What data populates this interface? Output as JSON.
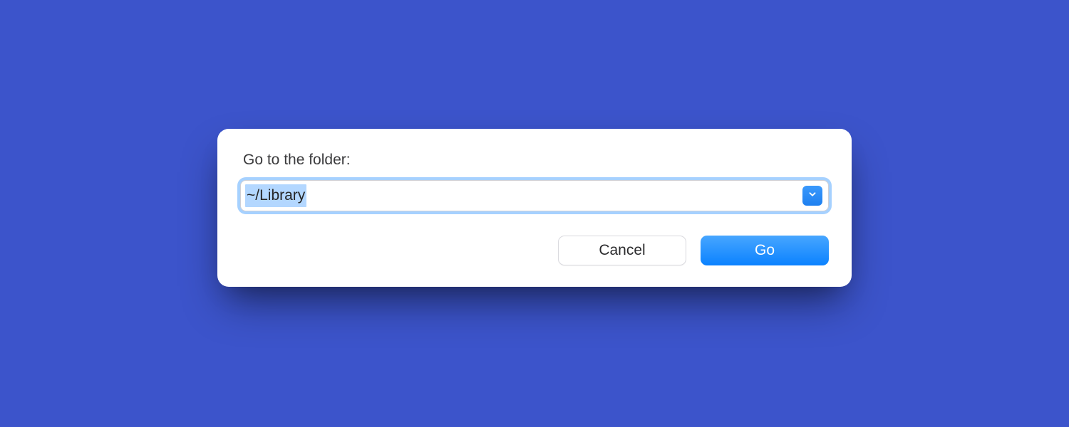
{
  "dialog": {
    "label": "Go to the folder:",
    "input_value": "~/Library",
    "buttons": {
      "cancel": "Cancel",
      "go": "Go"
    }
  },
  "colors": {
    "background": "#3c54cb",
    "accent": "#0b82ff",
    "selection": "#b3d7ff"
  }
}
